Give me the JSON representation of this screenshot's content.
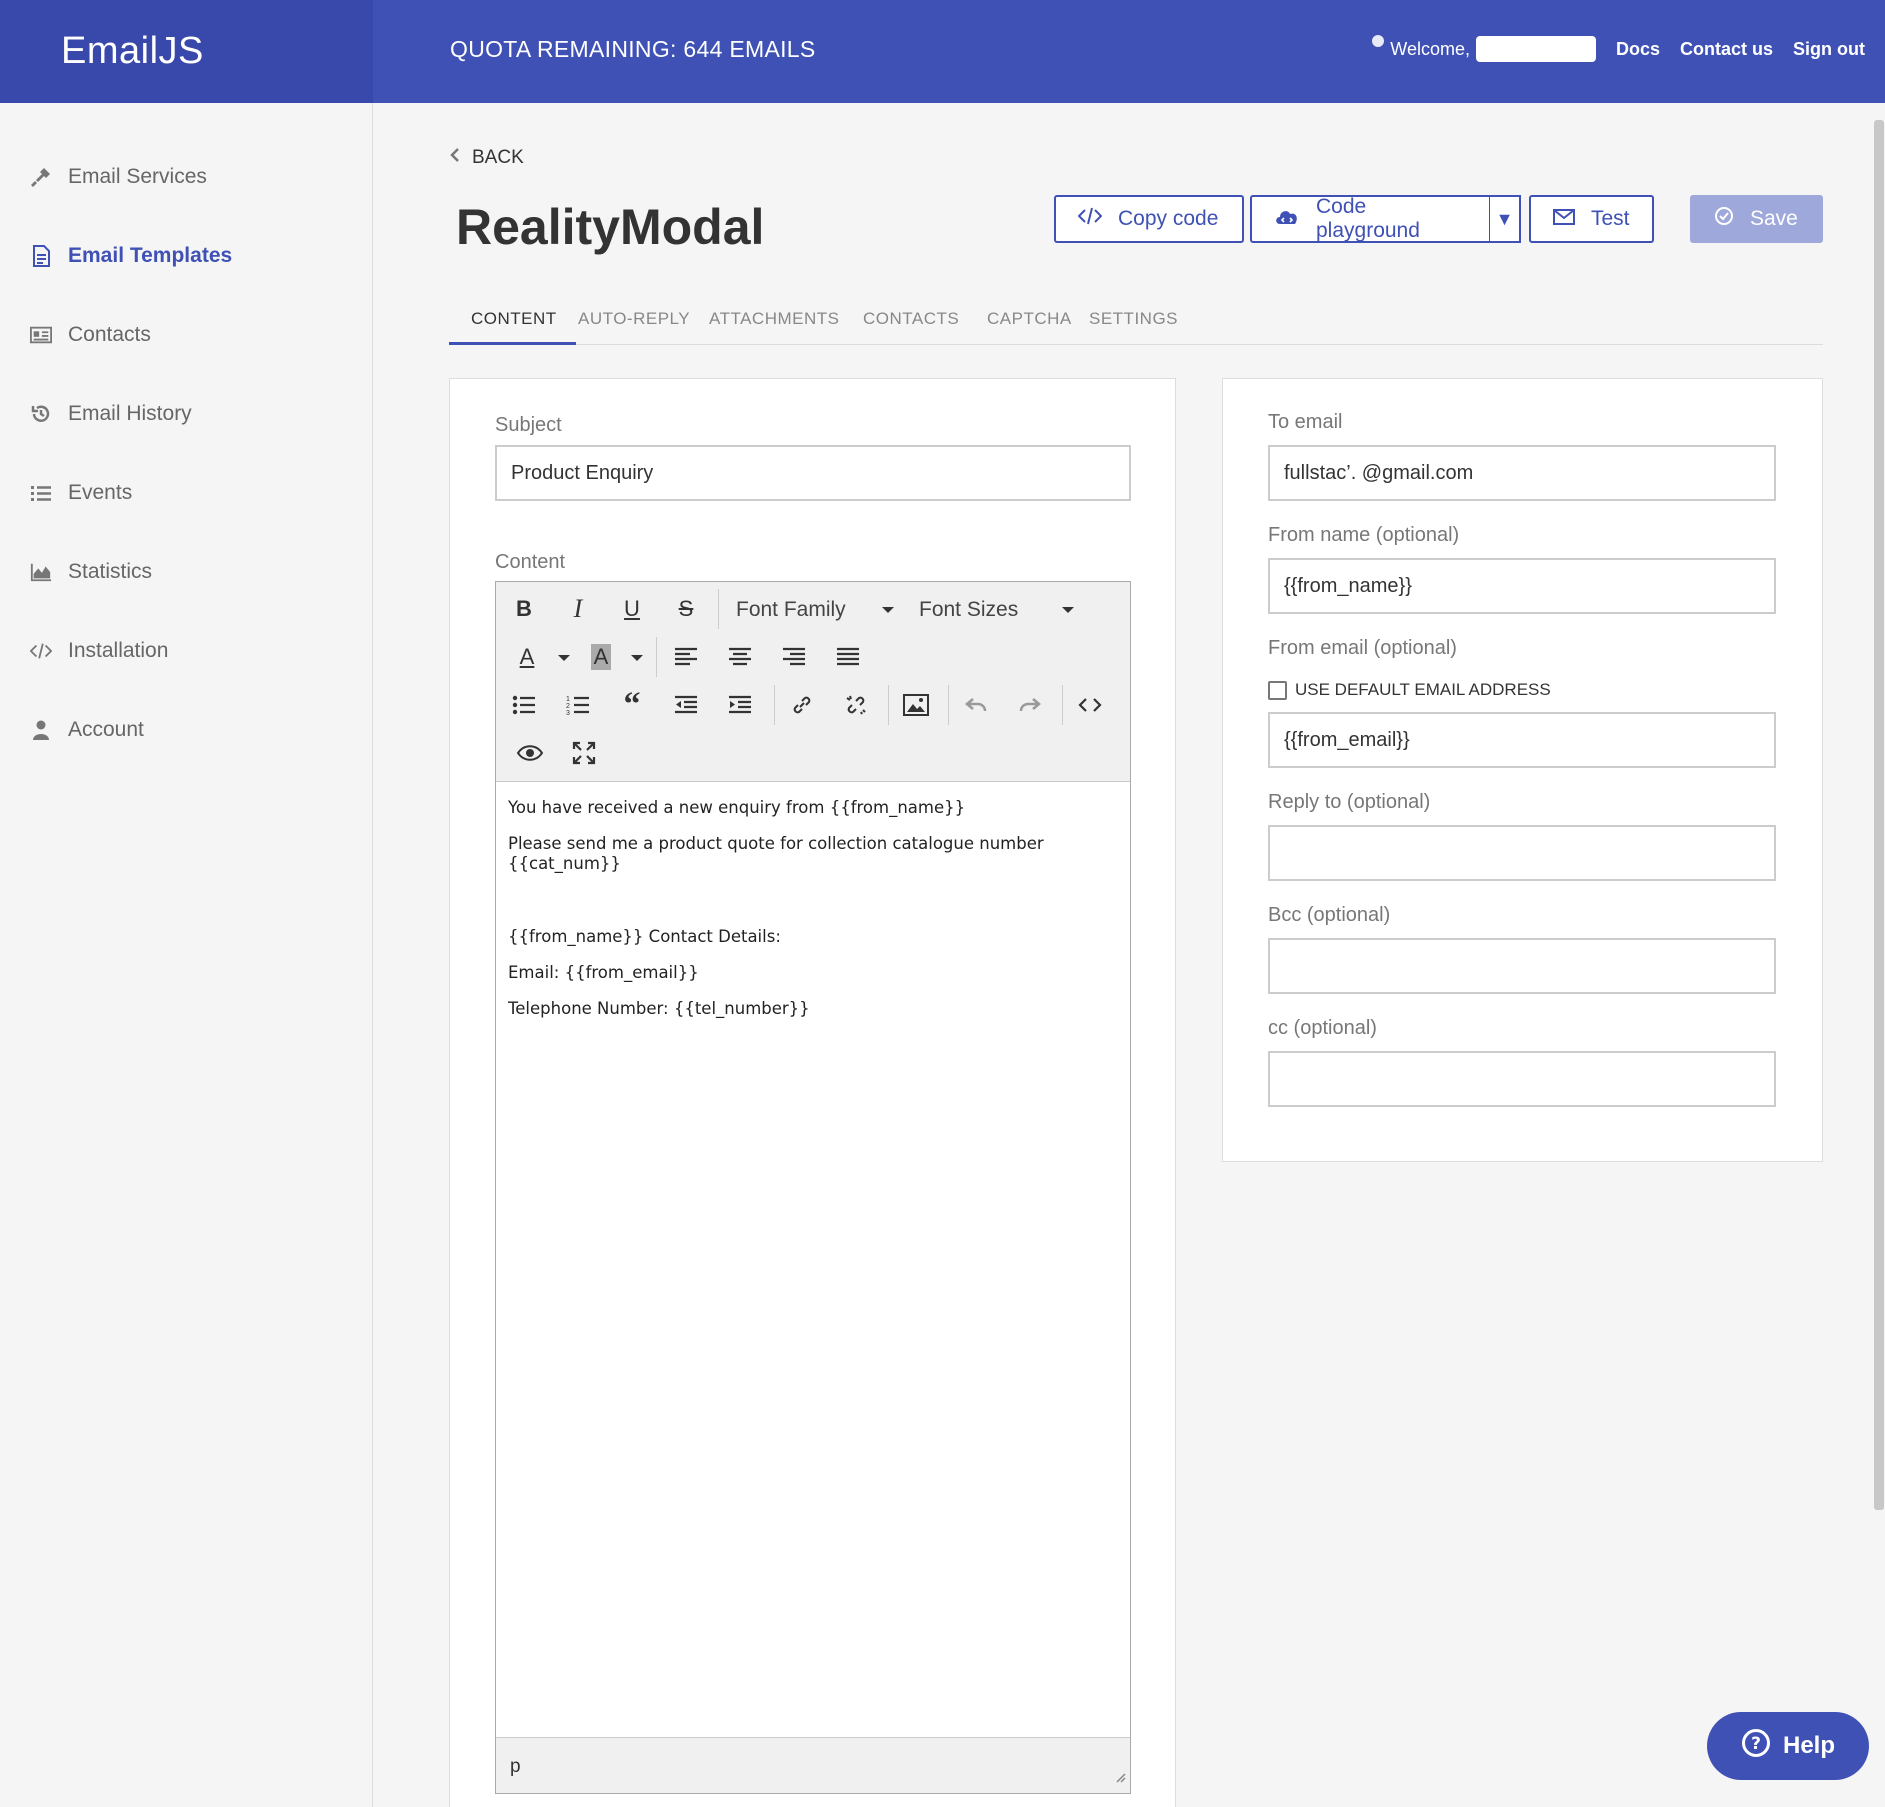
{
  "header": {
    "logo": "EmailJS",
    "quota": "QUOTA REMAINING: 644 EMAILS",
    "welcome": "Welcome,",
    "links": [
      "Docs",
      "Contact us",
      "Sign out"
    ]
  },
  "sidebar": {
    "items": [
      {
        "label": "Email Services",
        "icon": "plug-icon"
      },
      {
        "label": "Email Templates",
        "icon": "document-icon",
        "active": true
      },
      {
        "label": "Contacts",
        "icon": "contacts-card-icon"
      },
      {
        "label": "Email History",
        "icon": "history-icon"
      },
      {
        "label": "Events",
        "icon": "list-icon"
      },
      {
        "label": "Statistics",
        "icon": "area-chart-icon"
      },
      {
        "label": "Installation",
        "icon": "code-icon"
      },
      {
        "label": "Account",
        "icon": "user-icon"
      }
    ]
  },
  "main": {
    "back": "BACK",
    "title": "RealityModal",
    "buttons": {
      "copy_code": "Copy code",
      "playground": "Code playground",
      "test": "Test",
      "save": "Save"
    },
    "tabs": [
      "CONTENT",
      "AUTO-REPLY",
      "ATTACHMENTS",
      "CONTACTS",
      "CAPTCHA",
      "SETTINGS"
    ],
    "active_tab": "CONTENT"
  },
  "content_panel": {
    "subject_label": "Subject",
    "subject_value": "Product  Enquiry",
    "content_label": "Content",
    "toolbar": {
      "font_family": "Font Family",
      "font_sizes": "Font Sizes"
    },
    "body": [
      "You have received a new enquiry from {{from_name}}",
      "Please send me a product quote for collection catalogue number",
      "{{cat_num}}",
      "{{from_name}} Contact Details:",
      "Email: {{from_email}}",
      "Telephone Number: {{tel_number}}"
    ],
    "status_path": "p"
  },
  "settings_panel": {
    "to_email_label": "To email",
    "to_email_value": "fullstac’.         @gmail.com",
    "from_name_label": "From name (optional)",
    "from_name_value": "{{from_name}}",
    "from_email_label": "From email (optional)",
    "use_default_label": "USE DEFAULT EMAIL ADDRESS",
    "from_email_value": "{{from_email}}",
    "reply_to_label": "Reply to (optional)",
    "reply_to_value": "",
    "bcc_label": "Bcc (optional)",
    "bcc_value": "",
    "cc_label": "cc (optional)",
    "cc_value": ""
  },
  "help": {
    "label": "Help"
  },
  "colors": {
    "primary": "#3f51b5",
    "primary_dark": "#3949ab",
    "save_disabled": "#9fa8da"
  }
}
